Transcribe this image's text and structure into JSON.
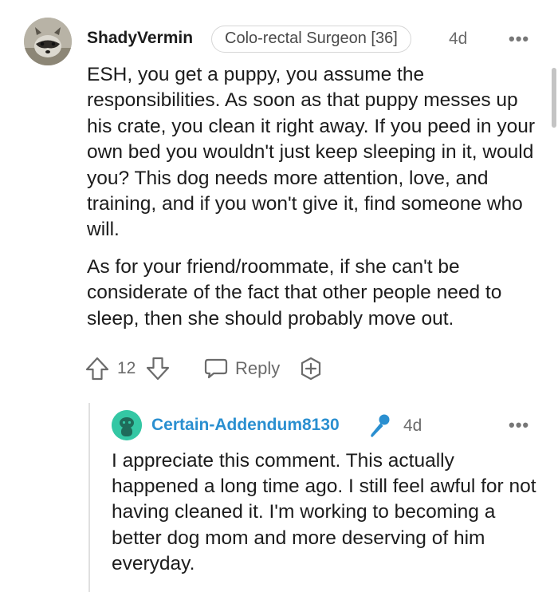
{
  "comment": {
    "username": "ShadyVermin",
    "flair": "Colo-rectal Surgeon [36]",
    "age": "4d",
    "more_label": "•••",
    "paragraphs": [
      "ESH, you get a puppy, you assume the responsibilities. As soon as that puppy messes up his crate, you clean it right away. If you peed in your own bed you wouldn't just keep sleeping in it, would you? This dog needs more attention, love, and training, and if you won't give it, find someone who will.",
      "As for your friend/roommate, if she can't be considerate of the fact that other people need to sleep, then she should probably move out."
    ],
    "vote_count": "12",
    "reply_label": "Reply",
    "icons": {
      "avatar": "raccoon-avatar",
      "upvote": "upvote-arrow-icon",
      "downvote": "downvote-arrow-icon",
      "reply": "speech-bubble-icon",
      "award": "award-plus-icon"
    }
  },
  "reply": {
    "username": "Certain-Addendum8130",
    "age": "4d",
    "more_label": "•••",
    "text": "I appreciate this comment. This actually happened a long time ago. I still feel awful for not having cleaned it. I'm working to becoming a better dog mom and more deserving of him everyday.",
    "icons": {
      "avatar": "snoo-avatar",
      "op_badge": "microphone-icon"
    }
  },
  "colors": {
    "text": "#1c1c1c",
    "muted": "#6b6b6b",
    "reply_username": "#2a8fd0",
    "reply_avatar": "#34c7a4",
    "thread_line": "#e0e0e0"
  }
}
